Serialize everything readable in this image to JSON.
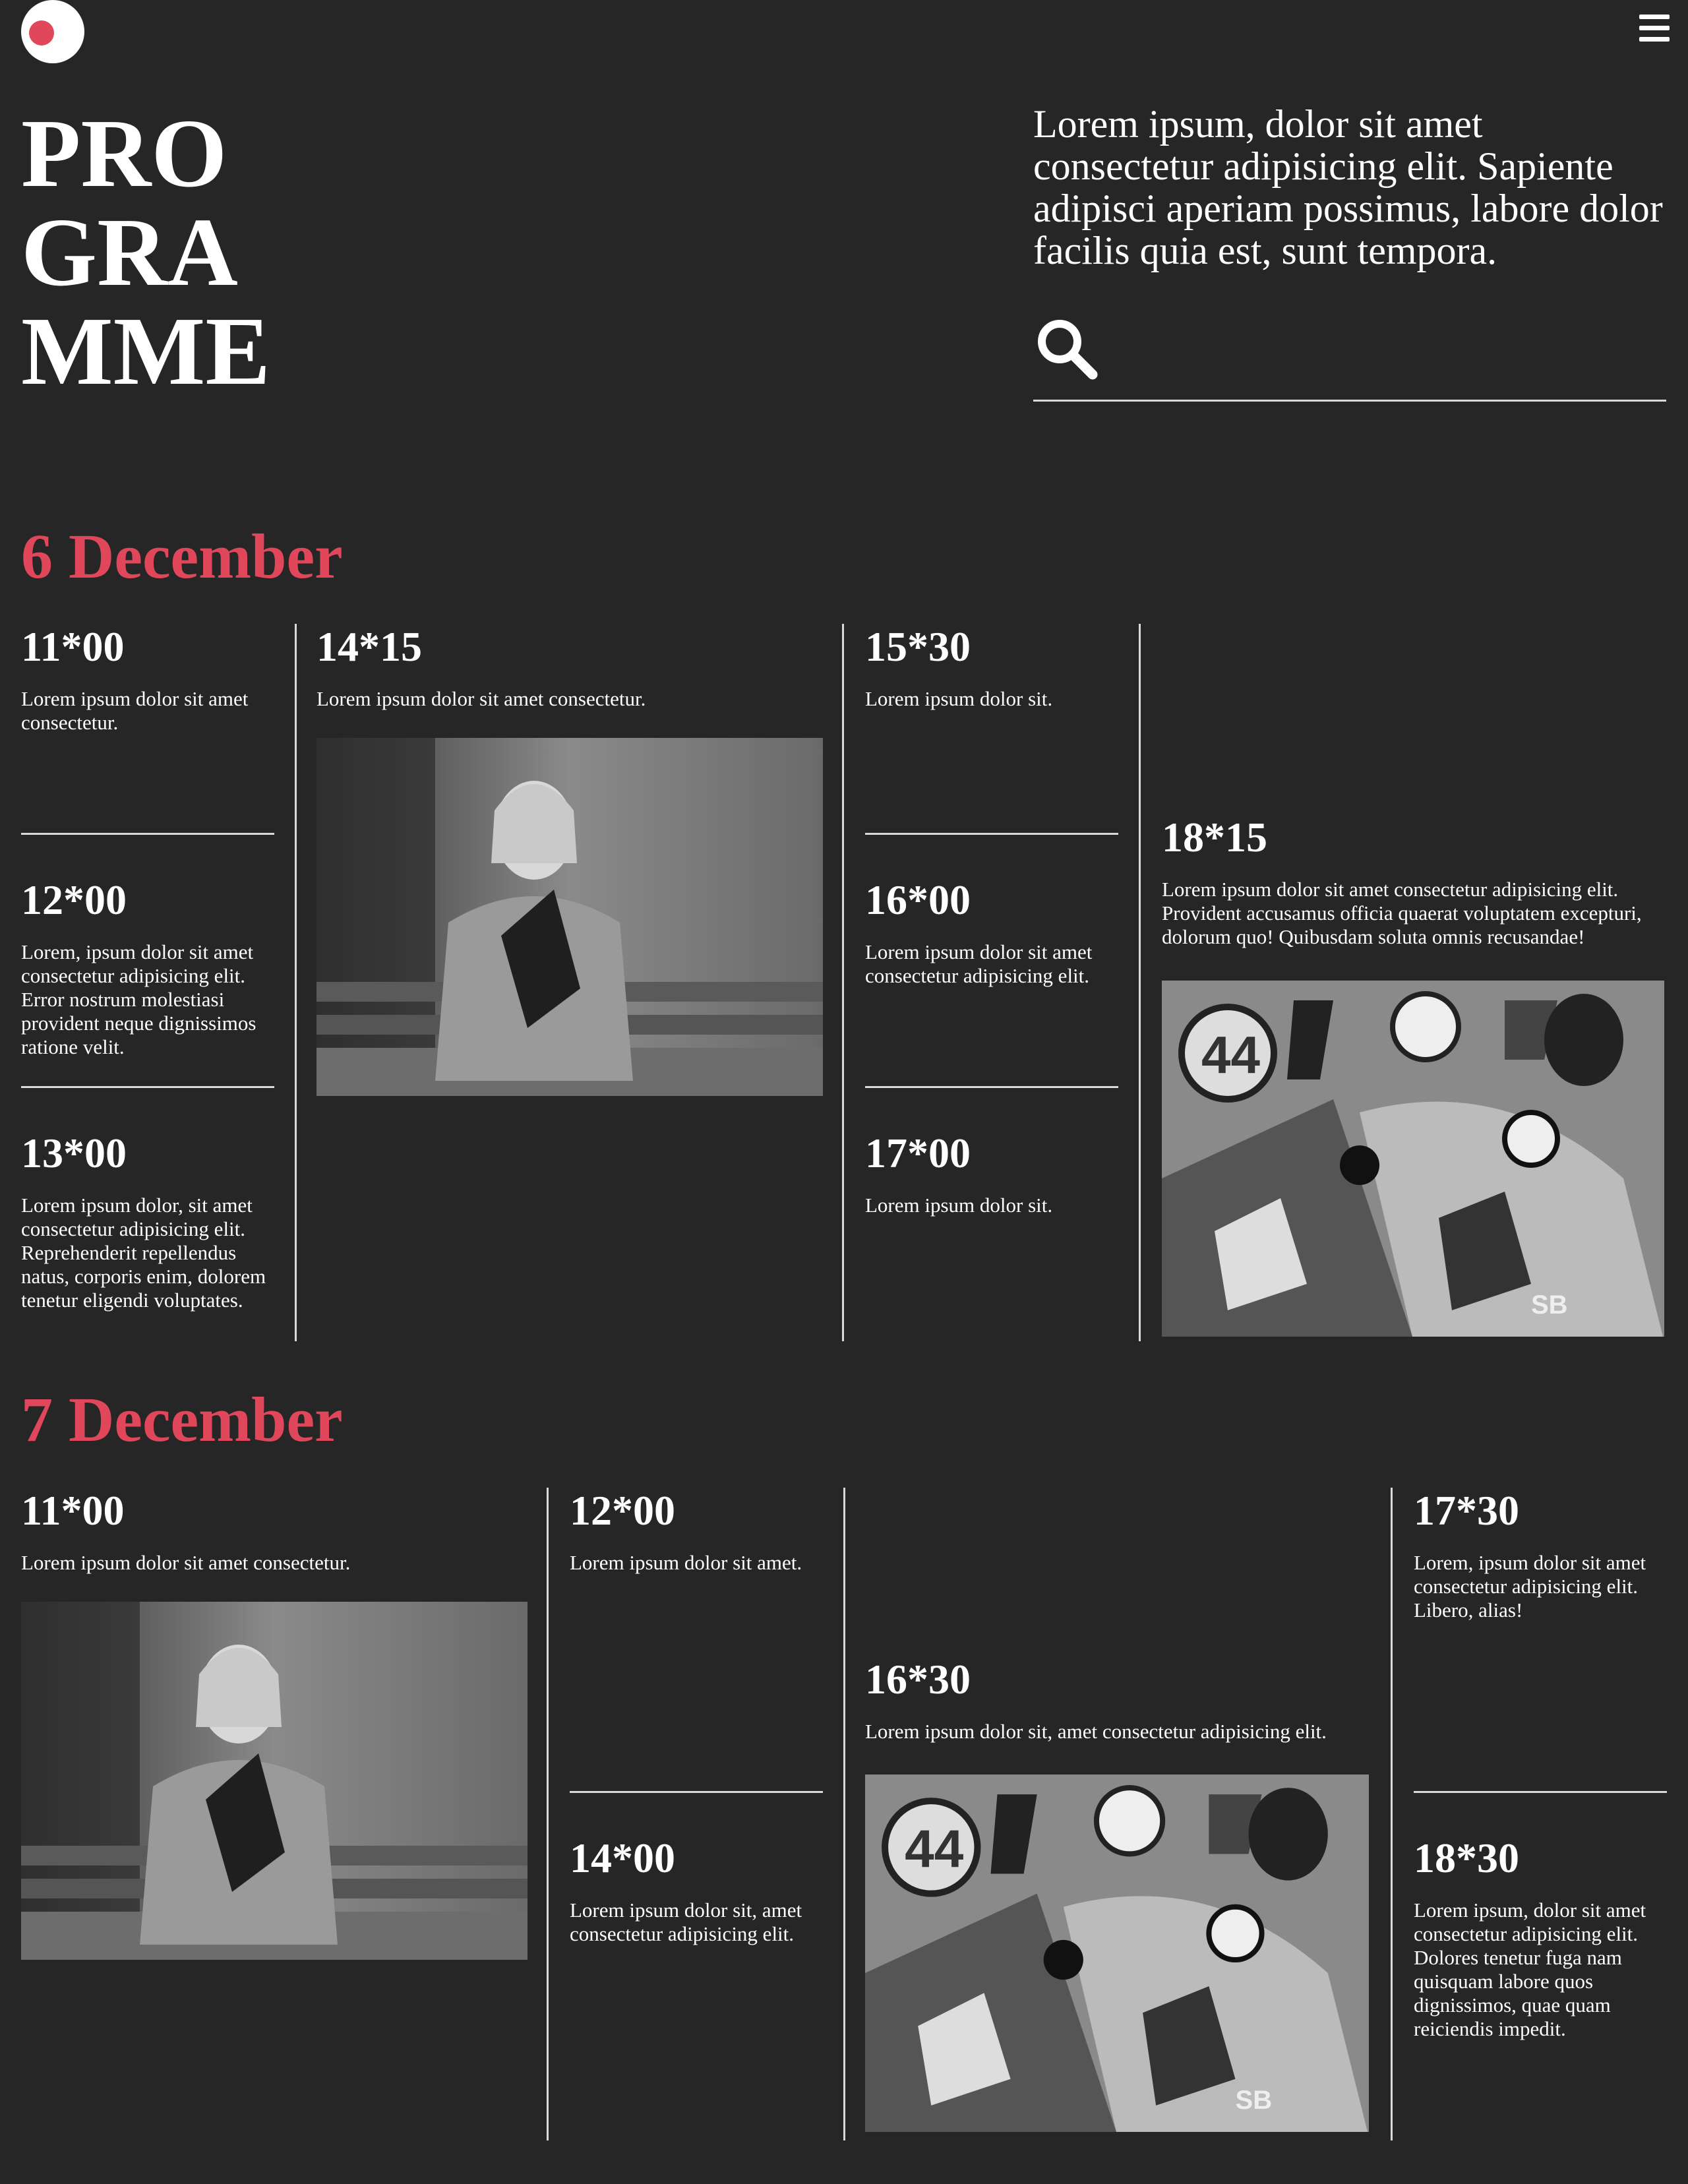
{
  "header": {
    "title_lines": [
      "PRO",
      "GRA",
      "MME"
    ],
    "intro": "Lorem ipsum, dolor sit amet consectetur adipisicing elit. Sapiente adipisci aperiam possimus, labore dolor facilis quia est, sunt tempora.",
    "search_placeholder": ""
  },
  "colors": {
    "background": "#262627",
    "accent": "#e0475b",
    "text": "#ffffff",
    "divider": "#d9d9d9"
  },
  "icons": {
    "logo": "logo-icon",
    "menu": "hamburger-menu-icon",
    "search": "search-icon"
  },
  "days": [
    {
      "title": "6 December",
      "events": [
        {
          "time": "11*00",
          "text": "Lorem ipsum dolor sit amet consectetur."
        },
        {
          "time": "12*00",
          "text": "Lorem, ipsum dolor sit amet consectetur adipisicing elit. Error nostrum molestiasi provident neque dignissimos ratione velit."
        },
        {
          "time": "13*00",
          "text": "Lorem ipsum dolor, sit amet consectetur adipisicing elit. Reprehenderit repellendus natus, corporis enim, dolorem tenetur eligendi voluptates."
        },
        {
          "time": "14*15",
          "text": "Lorem ipsum dolor sit amet consectetur."
        },
        {
          "time": "15*30",
          "text": "Lorem ipsum dolor sit."
        },
        {
          "time": "16*00",
          "text": "Lorem ipsum dolor sit amet consectetur adipisicing elit."
        },
        {
          "time": "17*00",
          "text": "Lorem ipsum dolor sit."
        },
        {
          "time": "18*15",
          "text": "Lorem ipsum dolor sit amet consectetur adipisicing elit. Provident accusamus officia quaerat voluptatem excepturi, dolorum quo! Quibusdam soluta omnis recusandae!"
        }
      ]
    },
    {
      "title": "7 December",
      "events": [
        {
          "time": "11*00",
          "text": "Lorem ipsum dolor sit amet consectetur."
        },
        {
          "time": "12*00",
          "text": "Lorem ipsum dolor sit amet."
        },
        {
          "time": "14*00",
          "text": "Lorem ipsum dolor sit, amet consectetur adipisicing elit."
        },
        {
          "time": "16*30",
          "text": "Lorem ipsum dolor sit, amet consectetur adipisicing elit."
        },
        {
          "time": "17*30",
          "text": "Lorem, ipsum dolor sit amet consectetur adipisicing elit. Libero, alias!"
        },
        {
          "time": "18*30",
          "text": "Lorem ipsum, dolor sit amet consectetur adipisicing elit. Dolores tenetur fuga nam quisquam labore quos dignissimos, quae quam reiciendis impedit."
        }
      ]
    }
  ]
}
